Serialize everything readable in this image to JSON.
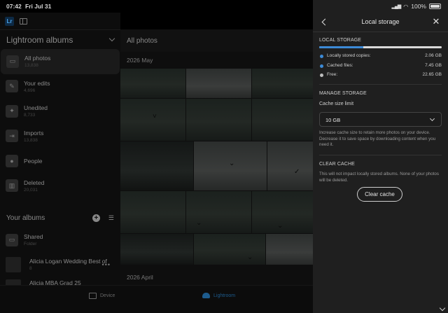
{
  "status_bar": {
    "time": "07:42",
    "date": "Fri Jul 31",
    "battery": "100%"
  },
  "app": {
    "logo": "Lr"
  },
  "sidebar": {
    "section_title": "Lightroom albums",
    "items": [
      {
        "label": "All photos",
        "count": "13,838",
        "icon": "photo-icon"
      },
      {
        "label": "Your edits",
        "count": "4,696",
        "icon": "pencil-icon"
      },
      {
        "label": "Unedited",
        "count": "8,733",
        "icon": "magic-wand-icon"
      },
      {
        "label": "Imports",
        "count": "13,838",
        "icon": "import-icon"
      },
      {
        "label": "People",
        "count": "",
        "icon": "person-icon"
      },
      {
        "label": "Deleted",
        "count": "20,031",
        "icon": "trash-icon"
      }
    ],
    "your_albums_title": "Your albums",
    "albums": [
      {
        "label": "Shared",
        "sub": "Folder"
      },
      {
        "label": "Alicia Logan Wedding Best of",
        "sub": "8"
      },
      {
        "label": "Alicia MBA Grad 25",
        "sub": ""
      }
    ]
  },
  "main": {
    "title": "All photos",
    "month_1": "2026 May",
    "month_2": "2026 April"
  },
  "bottom_tabs": {
    "device": "Device",
    "lightroom": "Lightroom"
  },
  "panel": {
    "title": "Local storage",
    "local_storage_heading": "LOCAL STORAGE",
    "usage_fraction": 0.36,
    "legend": [
      {
        "label": "Locally stored copies:",
        "value": "2.06 GB",
        "color": "#3c8ad6"
      },
      {
        "label": "Cached files:",
        "value": "7.45 GB",
        "color": "#3c8ad6"
      },
      {
        "label": "Free:",
        "value": "22.65 GB",
        "color": "#bdbdbd"
      }
    ],
    "manage_heading": "MANAGE STORAGE",
    "cache_label": "Cache size limit",
    "cache_value": "10 GB",
    "cache_help": "Increase cache size to retain more photos on your device. Decrease it to save space by downloading content when you need it.",
    "clear_heading": "CLEAR CACHE",
    "clear_help": "This will not impact locally stored albums. None of your photos will be deleted.",
    "clear_button": "Clear cache"
  }
}
